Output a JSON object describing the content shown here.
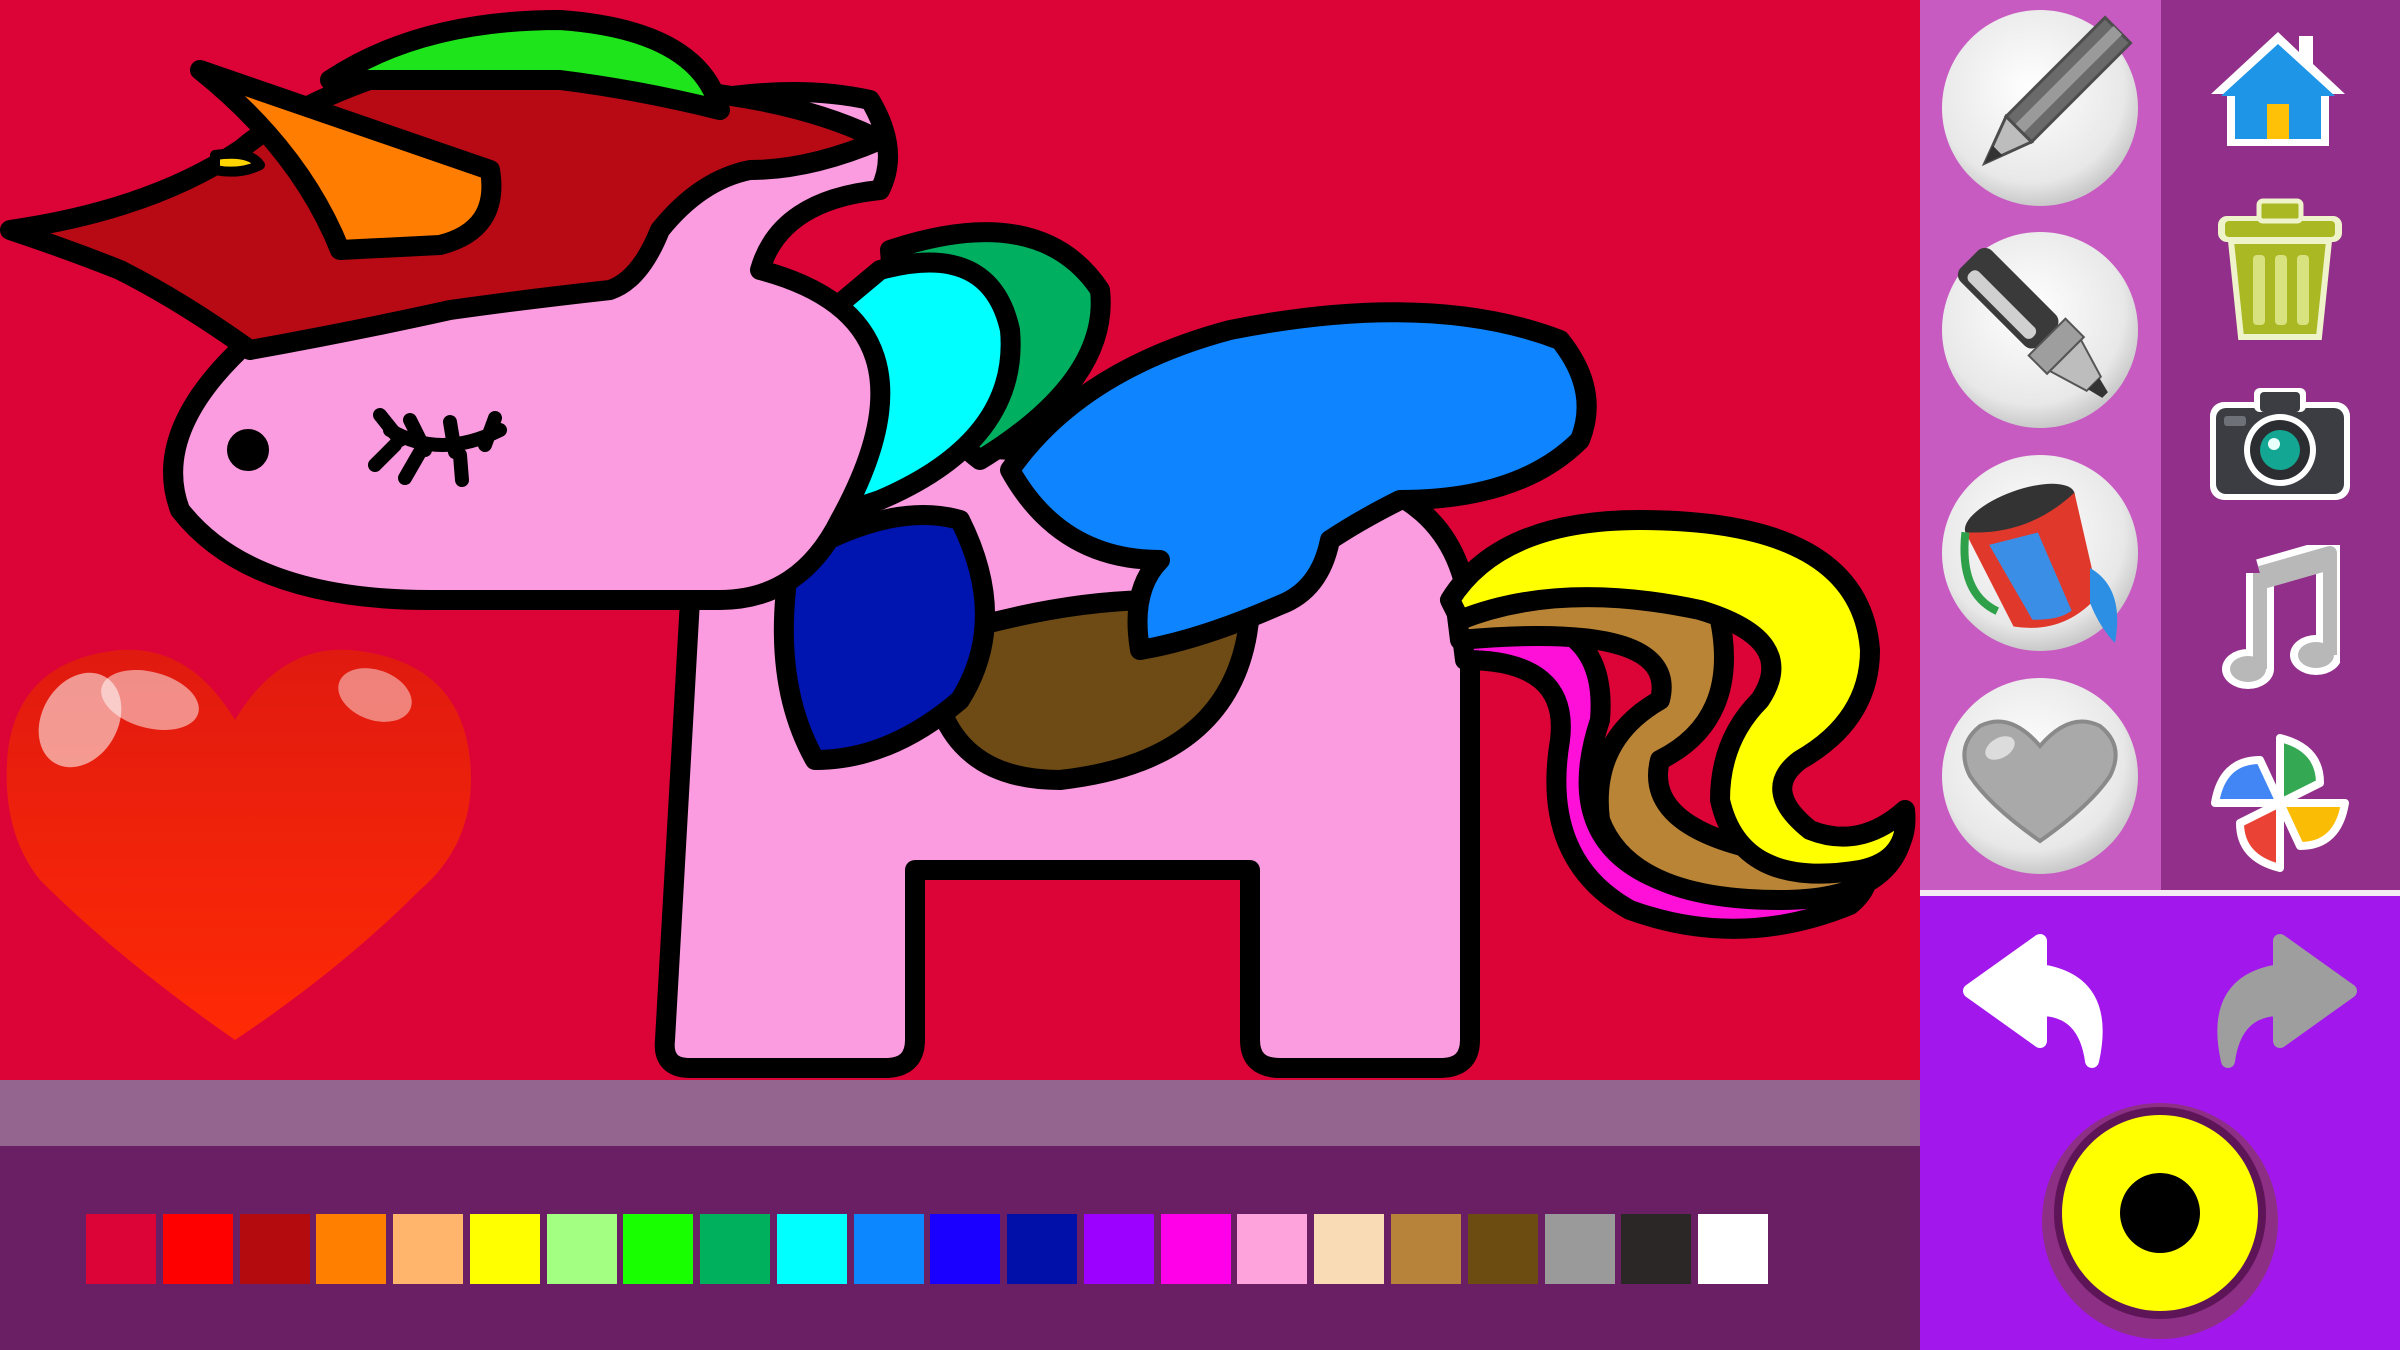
{
  "app": {
    "canvas_background": "#dc0437",
    "pony": {
      "body": "#fb9be0",
      "horn": "#ff7d00",
      "mane_top": "#1ee41c",
      "mane_front": "#b80a14",
      "mane_cyan": "#00ffff",
      "mane_green": "#00b060",
      "mane_navy": "#0014b0",
      "wing": "#0e84ff",
      "saddle": "#6e4b14",
      "tail_yellow": "#ffff00",
      "tail_brown": "#b98436",
      "tail_pink": "#ff10d8"
    },
    "sticker_heart_color": "#ff2a05"
  },
  "palette": {
    "selected": "#ffff00",
    "colors": [
      "#dc0437",
      "#ff0000",
      "#b40b0e",
      "#ff7f00",
      "#ffb66c",
      "#ffff00",
      "#a3ff82",
      "#18ff00",
      "#00b05c",
      "#00ffff",
      "#0c87ff",
      "#1a00ff",
      "#0010a8",
      "#9c00ff",
      "#ff00e8",
      "#ffa3dc",
      "#f9dbb6",
      "#b7833b",
      "#6d4c12",
      "#9a9a9a",
      "#2b2727",
      "#ffffff"
    ]
  },
  "tools": [
    {
      "id": "pencil",
      "icon": "pencil-icon"
    },
    {
      "id": "marker",
      "icon": "marker-icon"
    },
    {
      "id": "fill-bucket",
      "icon": "paint-bucket-icon"
    },
    {
      "id": "stickers",
      "icon": "heart-sticker-icon"
    }
  ],
  "menu": [
    {
      "id": "home",
      "icon": "home-icon"
    },
    {
      "id": "clear",
      "icon": "trash-icon"
    },
    {
      "id": "save-photo",
      "icon": "camera-icon"
    },
    {
      "id": "music",
      "icon": "music-note-icon"
    },
    {
      "id": "gallery",
      "icon": "pinwheel-icon"
    }
  ],
  "history": {
    "undo_icon": "undo-arrow-icon",
    "redo_icon": "redo-arrow-icon",
    "redo_enabled": false
  },
  "brush": {
    "current_color": "#ffff00",
    "icon": "brush-size-icon"
  }
}
